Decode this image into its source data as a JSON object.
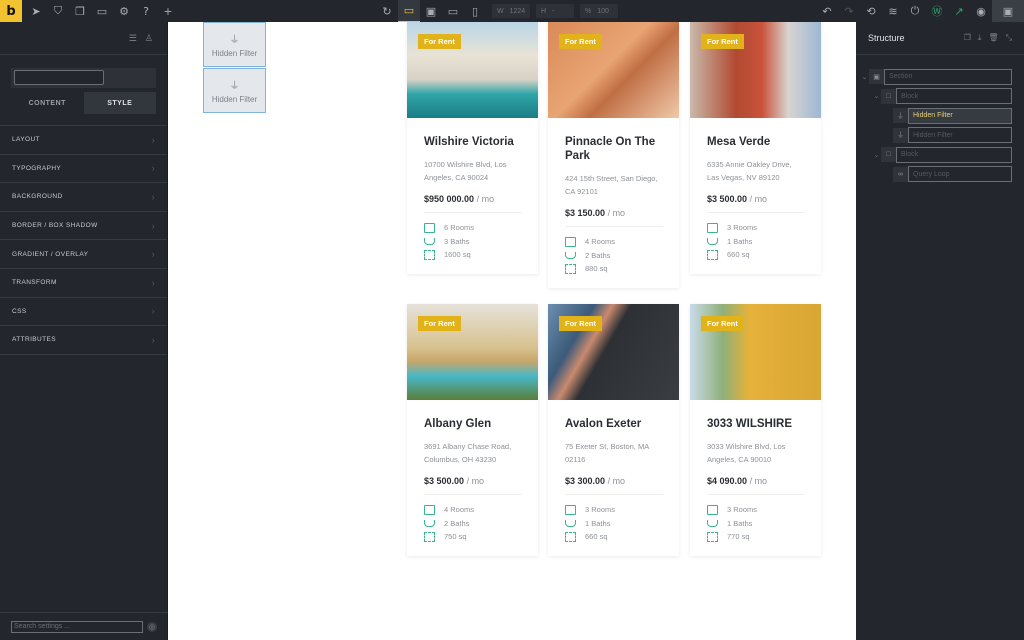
{
  "topbar": {
    "logo": "b",
    "left_icons": [
      "pointer-icon",
      "css3-icon",
      "pages-icon",
      "folder-icon",
      "gear-icon",
      "help-icon",
      "plus-icon"
    ],
    "center_icons": [
      "refresh-icon",
      "desktop-icon",
      "tablet-landscape-icon",
      "tablet-icon",
      "mobile-icon"
    ],
    "width_label": "W",
    "width_value": "1224",
    "height_label": "H",
    "height_value": "-",
    "zoom_label": "%",
    "zoom_value": "100",
    "right_icons": [
      "undo-icon",
      "redo-icon",
      "history-icon",
      "layers-icon",
      "power-icon",
      "wordpress-icon",
      "external-link-icon",
      "eye-icon",
      "structure-panel-icon"
    ]
  },
  "left_panel": {
    "search_placeholder": "",
    "tabs": [
      {
        "label": "CONTENT",
        "active": false
      },
      {
        "label": "STYLE",
        "active": true
      }
    ],
    "sections": [
      "LAYOUT",
      "TYPOGRAPHY",
      "BACKGROUND",
      "BORDER / BOX SHADOW",
      "GRADIENT / OVERLAY",
      "TRANSFORM",
      "CSS",
      "ATTRIBUTES"
    ],
    "footer_search_placeholder": "Search settings ..."
  },
  "canvas": {
    "hidden_filters": [
      "Hidden Filter",
      "Hidden Filter"
    ],
    "listings": [
      {
        "badge": "For Rent",
        "title": "Wilshire Victoria",
        "address": "10700 Wilshire Blvd, Los Angeles, CA 90024",
        "price": "$950 000.00",
        "period": "/ mo",
        "rooms": "6 Rooms",
        "baths": "3 Baths",
        "area": "1600 sq",
        "image": "modern villa with pool"
      },
      {
        "badge": "For Rent",
        "title": "Pinnacle On The Park",
        "address": "424 15th Street, San Diego, CA 92101",
        "price": "$3 150.00",
        "period": "/ mo",
        "rooms": "4 Rooms",
        "baths": "2 Baths",
        "area": "880 sq",
        "image": "orange apartment building"
      },
      {
        "badge": "For Rent",
        "title": "Mesa Verde",
        "address": "6335 Annie Oakley Drive, Las Vegas, NV 89120",
        "price": "$3 500.00",
        "period": "/ mo",
        "rooms": "3 Rooms",
        "baths": "1 Baths",
        "area": "660 sq",
        "image": "red brick row buildings"
      },
      {
        "badge": "For Rent",
        "title": "Albany Glen",
        "address": "3691 Albany Chase Road, Columbus, OH 43230",
        "price": "$3 500.00",
        "period": "/ mo",
        "rooms": "4 Rooms",
        "baths": "2 Baths",
        "area": "750 sq",
        "image": "mansion with palm trees and pool"
      },
      {
        "badge": "For Rent",
        "title": "Avalon Exeter",
        "address": "75 Exeter St, Boston, MA 02116",
        "price": "$3 300.00",
        "period": "/ mo",
        "rooms": "3 Rooms",
        "baths": "1 Baths",
        "area": "660 sq",
        "image": "dark modern facade"
      },
      {
        "badge": "For Rent",
        "title": "3033 WILSHIRE",
        "address": "3033 Wilshire Blvd, Los Angeles, CA 90010",
        "price": "$4 090.00",
        "period": "/ mo",
        "rooms": "3 Rooms",
        "baths": "1 Baths",
        "area": "770 sq",
        "image": "yellow apartment building"
      }
    ]
  },
  "right_panel": {
    "title": "Structure",
    "actions": [
      "copy-icon",
      "download-icon",
      "delete-icon",
      "collapse-icon"
    ],
    "tree": [
      {
        "level": 0,
        "label": "Section",
        "icon": "section-icon",
        "caret": true,
        "selected": false
      },
      {
        "level": 1,
        "label": "Block",
        "icon": "block-icon",
        "caret": true,
        "selected": false
      },
      {
        "level": 2,
        "label": "Hidden Filter",
        "icon": "filter-icon",
        "caret": false,
        "selected": true
      },
      {
        "level": 2,
        "label": "Hidden Filter",
        "icon": "filter-icon",
        "caret": false,
        "selected": false
      },
      {
        "level": 1,
        "label": "Block",
        "icon": "block-icon",
        "caret": true,
        "selected": false
      },
      {
        "level": 2,
        "label": "Query Loop",
        "icon": "loop-icon",
        "caret": false,
        "selected": false
      }
    ]
  },
  "colors": {
    "accent": "#f2c230",
    "badge": "#e2b21a",
    "icon_green": "#3bb58a",
    "panel_bg": "#23262c"
  }
}
